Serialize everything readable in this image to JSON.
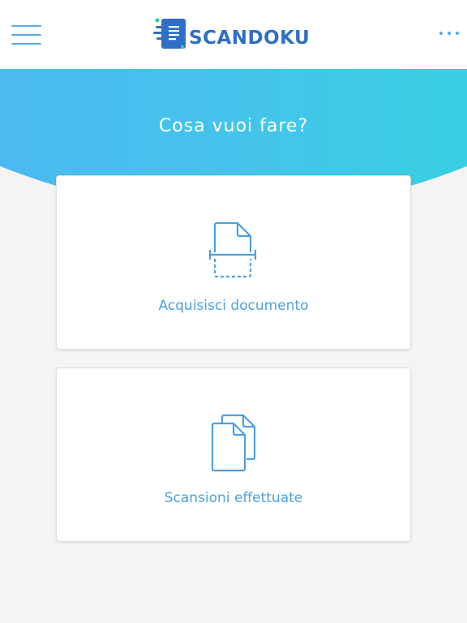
{
  "header": {
    "menu_icon": "hamburger-icon",
    "logo_text": "SCANDOKU",
    "more_icon": "ellipsis-icon"
  },
  "hero": {
    "title": "Cosa vuoi fare?"
  },
  "actions": [
    {
      "label": "Acquisisci documento",
      "icon": "scan-document-icon"
    },
    {
      "label": "Scansioni effettuate",
      "icon": "documents-icon"
    }
  ],
  "colors": {
    "accent": "#4aa0e2",
    "logo": "#2f6fc6",
    "gradient_start": "#52aef5",
    "gradient_end": "#2bdcd6",
    "background": "#f4f4f4"
  }
}
